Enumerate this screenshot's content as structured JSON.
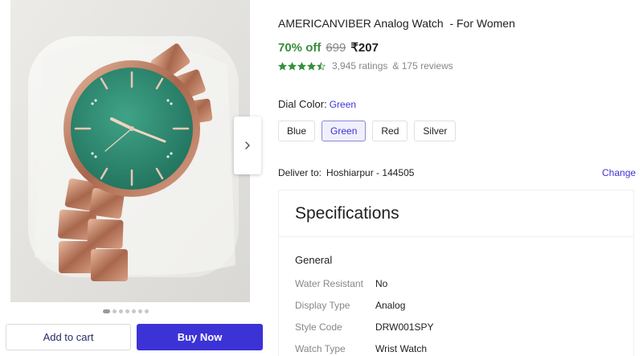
{
  "product": {
    "title": "AMERICANVIBER Analog Watch  - For Women",
    "discount": "70% off",
    "mrp": "699",
    "price": "₹207",
    "ratings": "3,945 ratings",
    "reviews": "& 175 reviews",
    "stars_filled": 4.5,
    "star_color": "#388e3c"
  },
  "gallery": {
    "slide_count": 7,
    "active_slide": 1
  },
  "dial": {
    "label": "Dial Color:",
    "value": "Green",
    "options": [
      "Blue",
      "Green",
      "Red",
      "Silver"
    ],
    "selected": "Green"
  },
  "delivery": {
    "label": "Deliver to:",
    "location": "Hoshiarpur - 144505",
    "change": "Change"
  },
  "actions": {
    "add_to_cart": "Add to cart",
    "buy_now": "Buy Now"
  },
  "specifications": {
    "heading": "Specifications",
    "section": "General",
    "rows": [
      {
        "key": "Water Resistant",
        "value": "No"
      },
      {
        "key": "Display Type",
        "value": "Analog"
      },
      {
        "key": "Style Code",
        "value": "DRW001SPY"
      },
      {
        "key": "Watch Type",
        "value": "Wrist Watch"
      }
    ]
  },
  "colors": {
    "accent": "#3c33d6",
    "discount": "#388e3c",
    "dial": "#2f8a72"
  }
}
